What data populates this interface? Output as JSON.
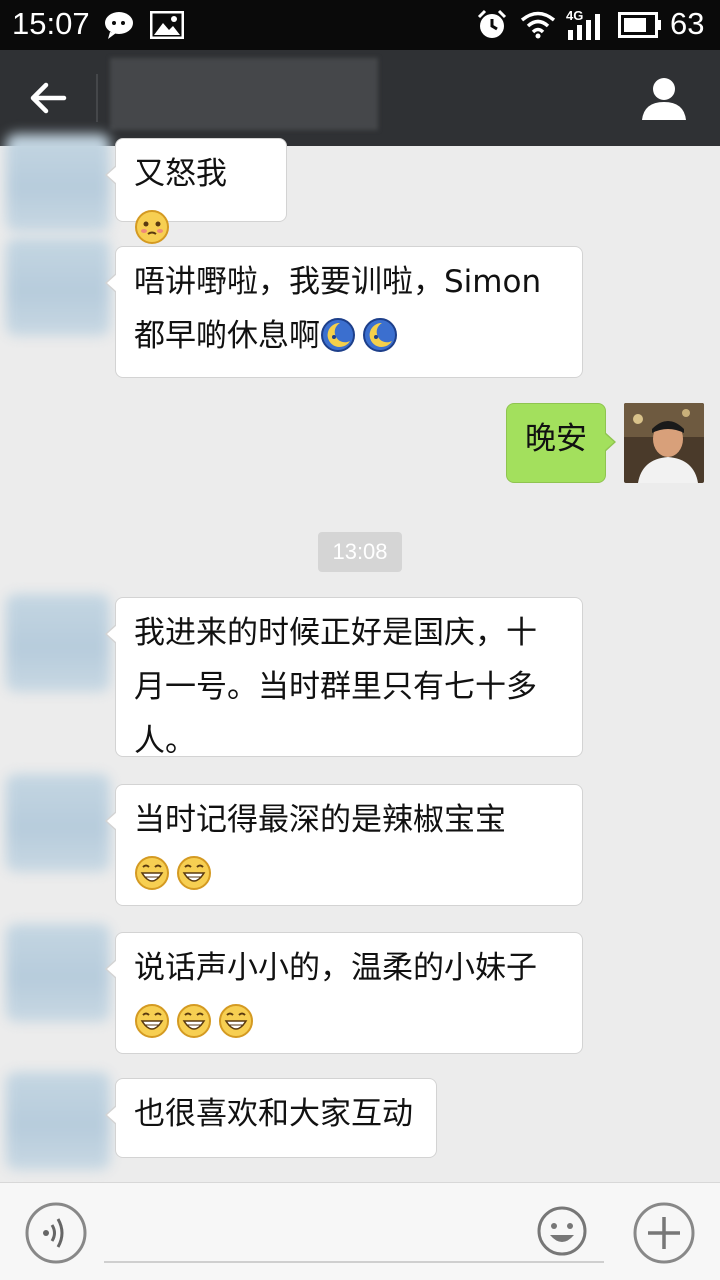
{
  "status_bar": {
    "time": "15:07",
    "network": "4G",
    "battery": "63",
    "icons": [
      "wechat-icon",
      "image-icon",
      "alarm-icon",
      "wifi-icon",
      "signal-icon",
      "battery-icon"
    ]
  },
  "header": {
    "back_icon": "back-arrow-icon",
    "title": "",
    "profile_icon": "person-icon"
  },
  "messages": [
    {
      "side": "left",
      "text": "又怒我",
      "emoji": [
        "blush-emoji"
      ]
    },
    {
      "side": "left",
      "text": "唔讲嘢啦，我要训啦，Simon\n都早啲休息啊",
      "emoji": [
        "sleepy-moon-emoji",
        "sleepy-moon-emoji"
      ]
    },
    {
      "side": "right",
      "text": "晚安",
      "emoji": []
    },
    {
      "side": "time",
      "text": "13:08"
    },
    {
      "side": "left",
      "text": "我进来的时候正好是国庆，十\n月一号。当时群里只有七十多\n人。",
      "emoji": []
    },
    {
      "side": "left",
      "text": "当时记得最深的是辣椒宝宝",
      "emoji": [
        "grin-emoji",
        "grin-emoji"
      ]
    },
    {
      "side": "left",
      "text": "说话声小小的，温柔的小妹子",
      "emoji": [
        "grin-emoji",
        "grin-emoji",
        "grin-emoji"
      ]
    },
    {
      "side": "left",
      "text": "也很喜欢和大家互动",
      "emoji": []
    }
  ],
  "input_bar": {
    "voice_icon": "voice-icon",
    "placeholder": "",
    "emoji_icon": "smiley-icon",
    "plus_icon": "plus-icon"
  },
  "colors": {
    "status_bar_bg": "#0a0a0a",
    "title_bar_bg": "#2f3134",
    "chat_bg": "#ececec",
    "my_bubble": "#a3e05d",
    "their_bubble": "#ffffff"
  }
}
